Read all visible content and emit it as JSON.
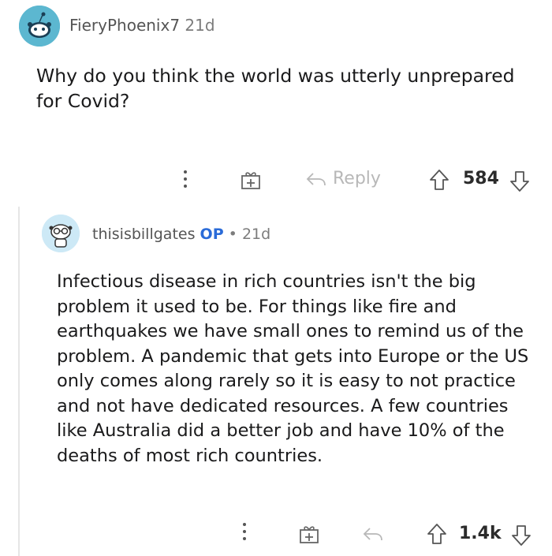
{
  "post": {
    "author": "FieryPhoenix7",
    "age": "21d",
    "text": "Why do you think the world was utterly unprepared for Covid?",
    "reply_label": "Reply",
    "score": "584"
  },
  "reply": {
    "author": "thisisbillgates",
    "op_badge": "OP",
    "separator": "•",
    "age": "21d",
    "text": "Infectious disease in rich countries isn't the big problem it used to be. For things like fire and earthquakes we have small ones to remind us of the problem. A pandemic that gets into Europe or the US only comes along rarely so it is easy to not practice and not have dedicated resources. A few countries like Australia did a better job and have 10% of the deaths of most rich countries.",
    "score": "1.4k"
  },
  "colors": {
    "accent_op": "#2a6bd8",
    "avatar1": "#5cb7d0",
    "avatar2": "#cde9f6"
  },
  "icons": [
    "more-icon",
    "gift-icon",
    "reply-icon",
    "upvote-icon",
    "downvote-icon"
  ]
}
